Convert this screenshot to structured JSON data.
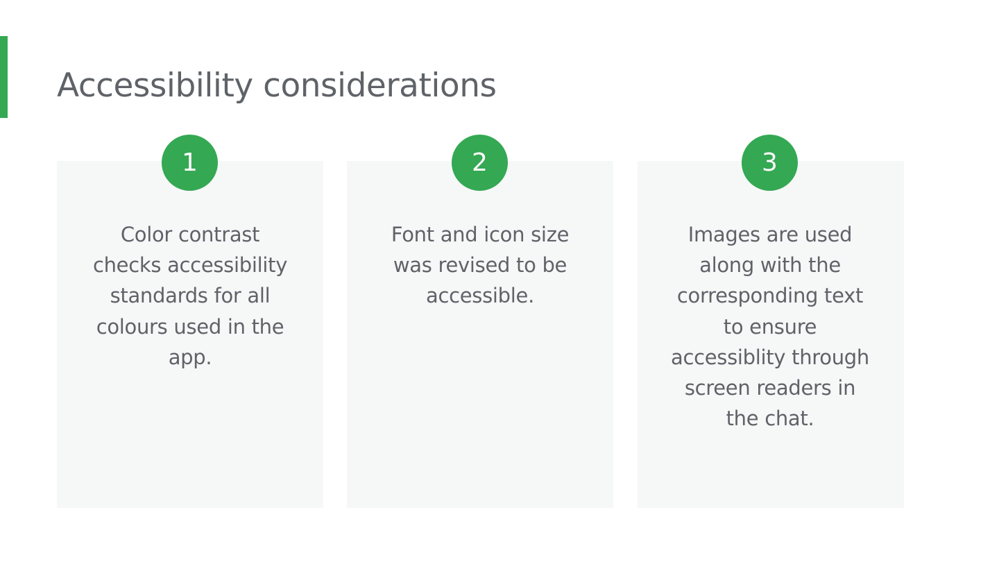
{
  "slide": {
    "title": "Accessibility considerations",
    "accent_color": "#34a853",
    "cards": [
      {
        "number": "1",
        "text": "Color contrast checks accessibility standards for all colours used in the app."
      },
      {
        "number": "2",
        "text": "Font and icon size was revised to be accessible."
      },
      {
        "number": "3",
        "text": "Images are used along with the corresponding text to ensure accessiblity through screen readers in the chat."
      }
    ]
  }
}
